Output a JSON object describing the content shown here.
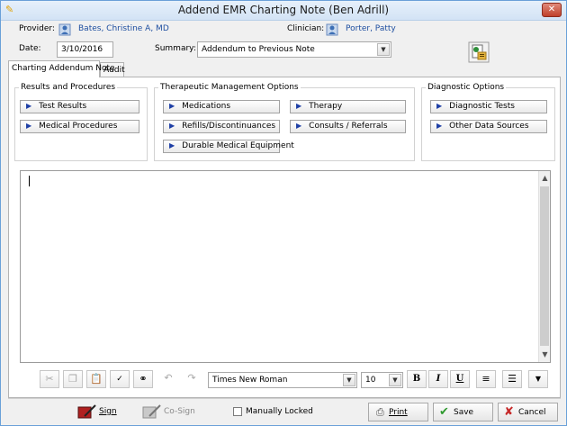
{
  "window": {
    "title": "Addend EMR Charting Note (Ben Adrill)",
    "close_icon": "close-icon"
  },
  "header": {
    "provider_label": "Provider:",
    "provider_name": "Bates, Christine A, MD",
    "clinician_label": "Clinician:",
    "clinician_name": "Porter, Patty",
    "date_label": "Date:",
    "date_value": "3/10/2016",
    "summary_label": "Summary:",
    "summary_value": "Addendum to Previous Note"
  },
  "tabs": [
    {
      "label": "Charting Addendum Note",
      "active": true
    },
    {
      "label": "Audit",
      "active": false
    }
  ],
  "groups": {
    "results": {
      "title": "Results and Procedures",
      "items": [
        "Test Results",
        "Medical Procedures"
      ]
    },
    "therapeutic": {
      "title": "Therapeutic Management Options",
      "items": [
        "Medications",
        "Therapy",
        "Refills/Discontinuances",
        "Consults / Referrals",
        "Durable Medical Equipment"
      ]
    },
    "diagnostic": {
      "title": "Diagnostic Options",
      "items": [
        "Diagnostic Tests",
        "Other Data Sources"
      ]
    }
  },
  "toolbar": {
    "font_name": "Times New Roman",
    "font_size": "10",
    "bold_label": "B",
    "italic_label": "I",
    "underline_label": "U"
  },
  "footer": {
    "sign_label": "Sign",
    "cosign_label": "Co-Sign",
    "manually_locked_label": "Manually Locked",
    "manually_locked_checked": false,
    "print_label": "Print",
    "save_label": "Save",
    "cancel_label": "Cancel"
  },
  "colors": {
    "link_blue": "#1f4fa0",
    "save_check": "#2e9a2e",
    "cancel_x": "#c62828"
  }
}
